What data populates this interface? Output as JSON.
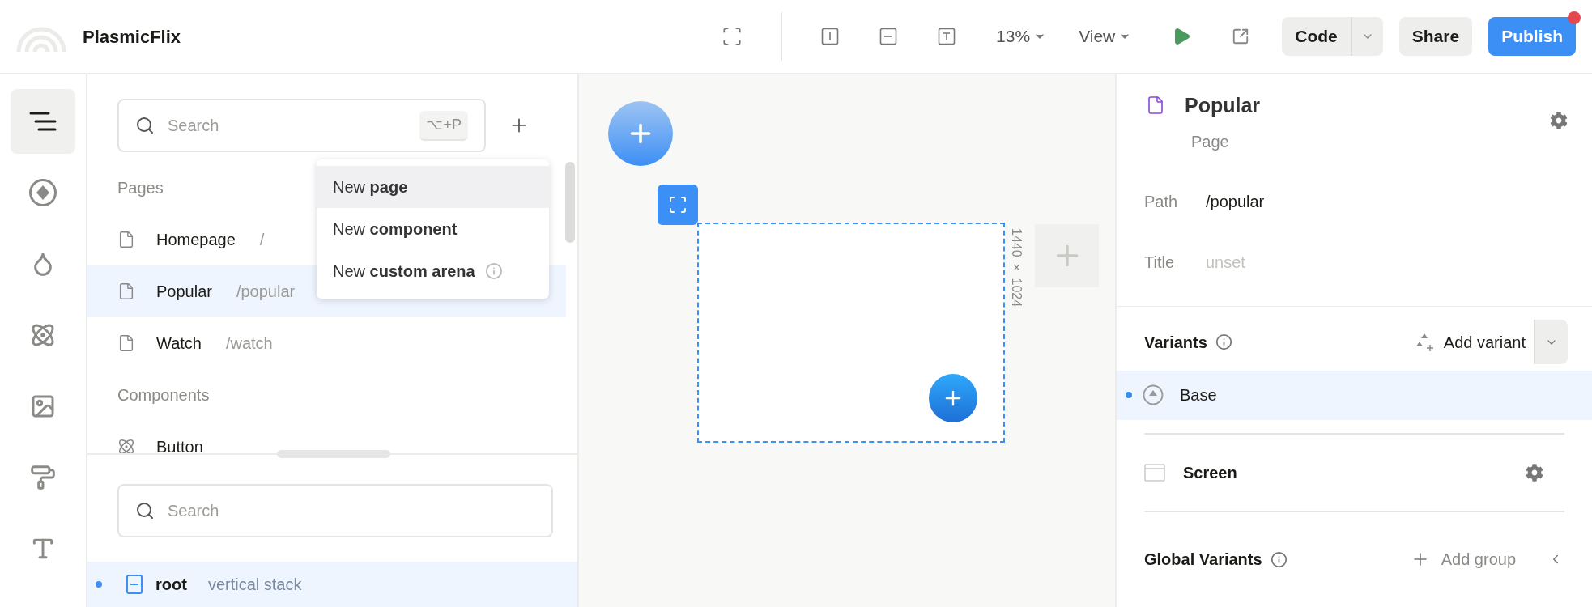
{
  "app": {
    "project_name": "PlasmicFlix"
  },
  "toolbar": {
    "zoom": "13%",
    "view_menu": "View",
    "buttons": [
      {
        "kind": "code",
        "label": "Code"
      },
      {
        "kind": "share",
        "label": "Share"
      },
      {
        "kind": "publish",
        "label": "Publish",
        "notification": true
      }
    ]
  },
  "rail": [
    {
      "kind": "outline",
      "selected": true
    },
    {
      "kind": "components",
      "selected": false
    },
    {
      "kind": "tokens",
      "selected": false
    },
    {
      "kind": "atom",
      "selected": false
    },
    {
      "kind": "images",
      "selected": false
    },
    {
      "kind": "styles",
      "selected": false
    },
    {
      "kind": "fonts",
      "selected": false
    }
  ],
  "project_panel": {
    "search": {
      "placeholder": "Search",
      "shortcut": "⌥+P"
    },
    "sections": [
      {
        "heading": "Pages",
        "items": [
          {
            "kind": "page",
            "name": "Homepage",
            "path": "/",
            "selected": false
          },
          {
            "kind": "page",
            "name": "Popular",
            "path": "/popular",
            "selected": true
          },
          {
            "kind": "page",
            "name": "Watch",
            "path": "/watch",
            "selected": false
          }
        ]
      },
      {
        "heading": "Components",
        "items": [
          {
            "kind": "component",
            "name": "Button",
            "selected": false
          }
        ]
      }
    ]
  },
  "add_menu": {
    "items": [
      {
        "label": "New **page**",
        "selected": true,
        "info": false
      },
      {
        "label": "New **component**",
        "selected": false,
        "info": false
      },
      {
        "label": "New **custom arena**",
        "selected": false,
        "info": true
      }
    ]
  },
  "outline_panel": {
    "search": {
      "placeholder": "Search"
    },
    "tree": [
      {
        "name": "root",
        "type": "vertical stack",
        "selected": true
      }
    ]
  },
  "canvas": {
    "frame": {
      "size": "1440 × 1024",
      "selected": true
    }
  },
  "inspector": {
    "title": "Popular",
    "subtitle": "Page",
    "fields": [
      {
        "label": "Path",
        "value": "/popular",
        "set": true
      },
      {
        "label": "Title",
        "value": "unset",
        "set": false
      }
    ],
    "variants": {
      "heading": "Variants",
      "add_label": "Add variant",
      "items": [
        {
          "name": "Base",
          "selected": true
        }
      ]
    },
    "screen": {
      "label": "Screen"
    },
    "global_variants": {
      "heading": "Global Variants",
      "add_label": "Add group"
    }
  }
}
